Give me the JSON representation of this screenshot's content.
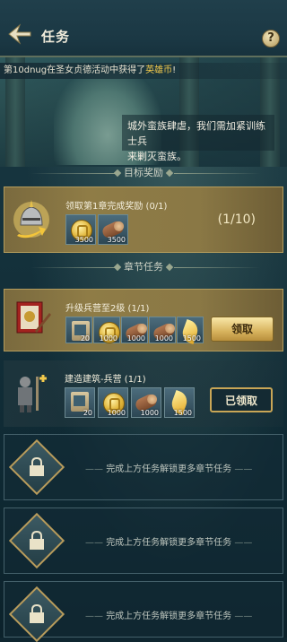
{
  "header": {
    "title": "任务"
  },
  "broadcast": {
    "prefix": "第1",
    "player": "0dnug",
    "text": "在圣女贞德活动中获得了",
    "item": "英雄币",
    "suffix": "!"
  },
  "npc": {
    "line1": "城外蛮族肆虐，我们需加紧训练士兵",
    "line2": "来剿灭蛮族。"
  },
  "sections": {
    "goal": "目标奖励",
    "chapter": "章节任务"
  },
  "goal_task": {
    "title": "领取第1章完成奖励 (0/1)",
    "progress": "(1/10)",
    "rewards": [
      {
        "icon": "gold-coin-icon",
        "qty": "3500"
      },
      {
        "icon": "wood-log-icon",
        "qty": "3500"
      }
    ]
  },
  "chapter_tasks": [
    {
      "title": "升级兵营至2级 (1/1)",
      "button": "领取",
      "button_state": "claim",
      "rewards": [
        {
          "icon": "scroll-icon",
          "qty": "20"
        },
        {
          "icon": "gold-coin-icon",
          "qty": "1000"
        },
        {
          "icon": "wood-log-icon",
          "qty": "1000"
        },
        {
          "icon": "wood-log-icon",
          "qty": "1000"
        },
        {
          "icon": "feather-icon",
          "qty": "1500"
        }
      ]
    },
    {
      "title": "建造建筑-兵营 (1/1)",
      "button": "已领取",
      "button_state": "claimed",
      "rewards": [
        {
          "icon": "scroll-icon",
          "qty": "20"
        },
        {
          "icon": "gold-coin-icon",
          "qty": "1000"
        },
        {
          "icon": "wood-log-icon",
          "qty": "1000"
        },
        {
          "icon": "feather-icon",
          "qty": "1500"
        }
      ]
    }
  ],
  "locked": [
    {
      "text": "完成上方任务解锁更多章节任务"
    },
    {
      "text": "完成上方任务解锁更多章节任务"
    },
    {
      "text": "完成上方任务解锁更多章节任务"
    }
  ],
  "colors": {
    "gold_accent": "#c9a656",
    "highlight": "#f2c94c"
  }
}
